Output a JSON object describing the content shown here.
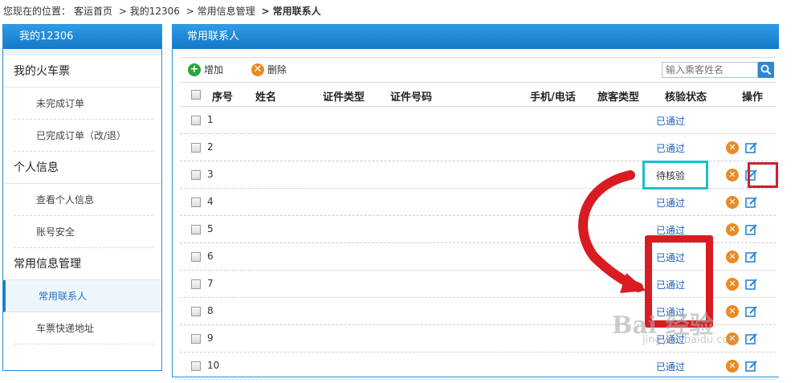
{
  "breadcrumb": {
    "prefix": "您现在的位置：",
    "items": [
      "客运首页",
      "> 我的12306",
      "> 常用信息管理",
      "> 常用联系人"
    ]
  },
  "sidebar": {
    "header": "我的12306",
    "sections": [
      {
        "title": "我的火车票",
        "items": [
          "未完成订单",
          "已完成订单（改/退）"
        ]
      },
      {
        "title": "个人信息",
        "items": [
          "查看个人信息",
          "账号安全"
        ]
      },
      {
        "title": "常用信息管理",
        "items": [
          "常用联系人",
          "车票快递地址"
        ]
      }
    ],
    "active_item": "常用联系人"
  },
  "main": {
    "header": "常用联系人",
    "toolbar": {
      "add_label": "增加",
      "delete_label": "删除",
      "search_placeholder": "输入乘客姓名"
    },
    "columns": [
      "序号",
      "姓名",
      "证件类型",
      "证件号码",
      "手机/电话",
      "旅客类型",
      "核验状态",
      "操作"
    ],
    "rows": [
      {
        "seq": "1",
        "status": "已通过"
      },
      {
        "seq": "2",
        "status": "已通过"
      },
      {
        "seq": "3",
        "status": "待核验"
      },
      {
        "seq": "4",
        "status": "已通过"
      },
      {
        "seq": "5",
        "status": "已通过"
      },
      {
        "seq": "6",
        "status": "已通过"
      },
      {
        "seq": "7",
        "status": "已通过"
      },
      {
        "seq": "8",
        "status": "已通过"
      },
      {
        "seq": "9",
        "status": "已通过"
      },
      {
        "seq": "10",
        "status": "已通过"
      }
    ]
  },
  "watermark": {
    "text": "Bai 经验",
    "sub": "jingyan.baidu.com"
  },
  "colors": {
    "accent": "#1a7fd0",
    "status_link": "#1a5fbf",
    "highlight_cyan": "#18c0c8",
    "highlight_red": "#d91b22"
  }
}
